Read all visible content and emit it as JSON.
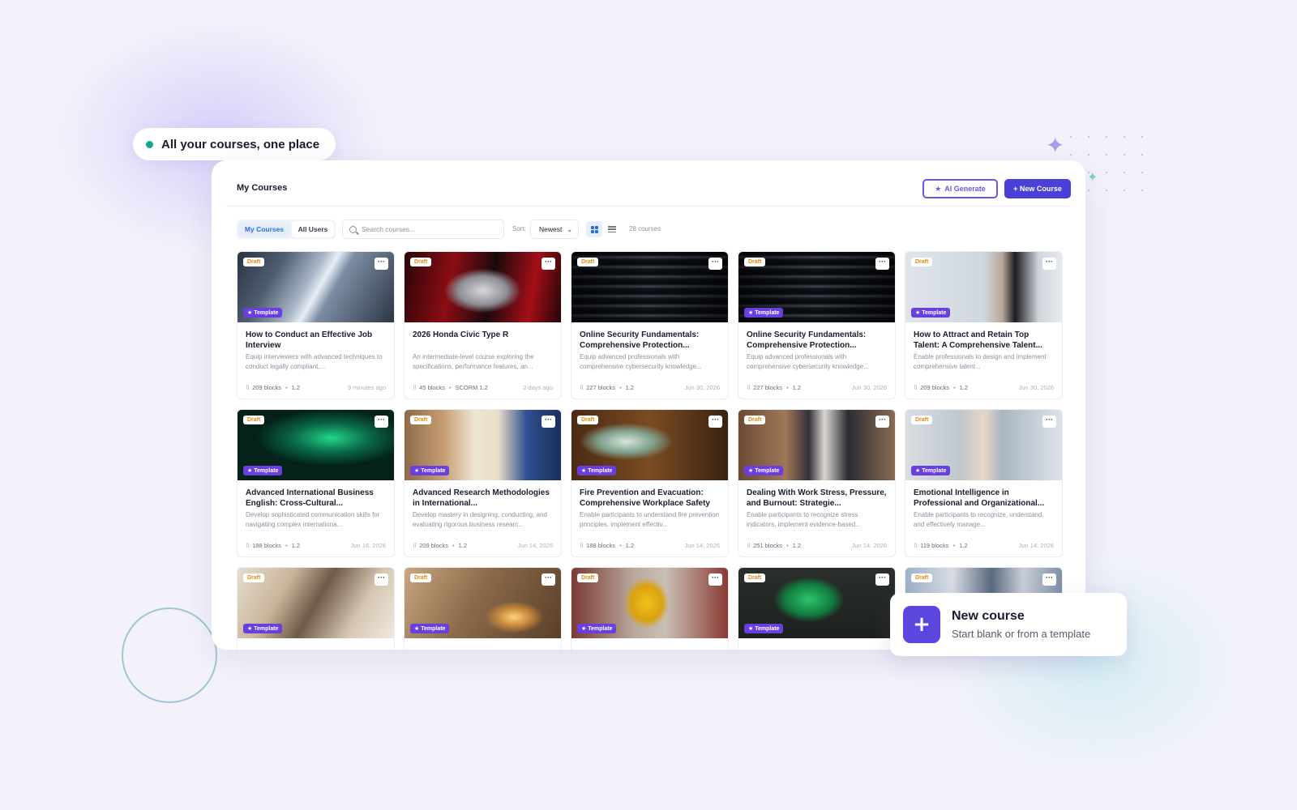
{
  "pill": {
    "label": "All your courses, one place"
  },
  "header": {
    "title": "My Courses",
    "ai_generate_label": "AI Generate",
    "new_course_label": "+ New Course"
  },
  "toolbar": {
    "tabs": [
      {
        "label": "My Courses",
        "active": true
      },
      {
        "label": "All Users",
        "active": false
      }
    ],
    "search_placeholder": "Search courses...",
    "sort_label": "Sort:",
    "sort_value": "Newest",
    "course_count": "28 courses"
  },
  "cards": [
    {
      "badge": "Draft",
      "template": "★ Template",
      "title": "How to Conduct an Effective Job Interview",
      "desc": "Equip interviewers with advanced techniques to conduct legally compliant,...",
      "blocks": "209 blocks",
      "version": "1.2",
      "date": "9 minutes ago",
      "thumb": "arch"
    },
    {
      "badge": "Draft",
      "template": "",
      "title": "2026 Honda Civic Type R",
      "desc": "An intermediate-level course exploring the specifications, performance features, an...",
      "blocks": "45 blocks",
      "version": "SCORM 1.2",
      "date": "2 days ago",
      "thumb": "car"
    },
    {
      "badge": "Draft",
      "template": "",
      "title": "Online Security Fundamentals: Comprehensive Protection...",
      "desc": "Equip advanced professionals with comprehensive cybersecurity knowledge...",
      "blocks": "227 blocks",
      "version": "1.2",
      "date": "Jun 30, 2026",
      "thumb": "server"
    },
    {
      "badge": "Draft",
      "template": "★ Template",
      "title": "Online Security Fundamentals: Comprehensive Protection...",
      "desc": "Equip advanced professionals with comprehensive cybersecurity knowledge...",
      "blocks": "227 blocks",
      "version": "1.2",
      "date": "Jun 30, 2026",
      "thumb": "server"
    },
    {
      "badge": "Draft",
      "template": "★ Template",
      "title": "How to Attract and Retain Top Talent: A Comprehensive Talent...",
      "desc": "Enable professionals to design and implement comprehensive talent...",
      "blocks": "209 blocks",
      "version": "1.2",
      "date": "Jun 30, 2026",
      "thumb": "woman"
    },
    {
      "badge": "Draft",
      "template": "★ Template",
      "title": "Advanced International Business English: Cross-Cultural...",
      "desc": "Develop sophisticated communication skills for navigating complex internationa...",
      "blocks": "188 blocks",
      "version": "1.2",
      "date": "Jun 16, 2026",
      "thumb": "green"
    },
    {
      "badge": "Draft",
      "template": "★ Template",
      "title": "Advanced Research Methodologies in International...",
      "desc": "Develop mastery in designing, conducting, and evaluating rigorous business researc...",
      "blocks": "209 blocks",
      "version": "1.2",
      "date": "Jun 14, 2026",
      "thumb": "writing"
    },
    {
      "badge": "Draft",
      "template": "★ Template",
      "title": "Fire Prevention and Evacuation: Comprehensive Workplace Safety",
      "desc": "Enable participants to understand fire prevention principles, implement effectiv...",
      "blocks": "188 blocks",
      "version": "1.2",
      "date": "Jun 14, 2026",
      "thumb": "exit"
    },
    {
      "badge": "Draft",
      "template": "★ Template",
      "title": "Dealing With Work Stress, Pressure, and Burnout: Strategie...",
      "desc": "Enable participants to recognize stress indicators, implement evidence-based...",
      "blocks": "251 blocks",
      "version": "1.2",
      "date": "Jun 14, 2026",
      "thumb": "stress"
    },
    {
      "badge": "Draft",
      "template": "★ Template",
      "title": "Emotional Intelligence in Professional and Organizational...",
      "desc": "Enable participants to recognize, understand, and effectively manage...",
      "blocks": "119 blocks",
      "version": "1.2",
      "date": "Jun 14, 2026",
      "thumb": "glasses"
    },
    {
      "badge": "Draft",
      "template": "★ Template",
      "title": "",
      "desc": "",
      "blocks": "",
      "version": "",
      "date": "",
      "thumb": "success"
    },
    {
      "badge": "Draft",
      "template": "★ Template",
      "title": "",
      "desc": "",
      "blocks": "",
      "version": "",
      "date": "",
      "thumb": "candle"
    },
    {
      "badge": "Draft",
      "template": "★ Template",
      "title": "",
      "desc": "",
      "blocks": "",
      "version": "",
      "date": "",
      "thumb": "caution"
    },
    {
      "badge": "Draft",
      "template": "★ Template",
      "title": "",
      "desc": "",
      "blocks": "",
      "version": "",
      "date": "",
      "thumb": "exitsign"
    },
    {
      "badge": "Draft",
      "template": "",
      "title": "",
      "desc": "",
      "blocks": "",
      "version": "",
      "date": "",
      "thumb": "office"
    }
  ],
  "toast": {
    "title": "New course",
    "subtitle": "Start blank or from a template"
  },
  "colors": {
    "accent": "#4a3fd9",
    "template_badge": "#6a3fe0",
    "draft_text": "#e08a12",
    "status_dot": "#10a98a"
  },
  "icons": {
    "ai": "sparkle-icon",
    "search": "search-icon",
    "menu": "more-icon",
    "blocks": "blocks-icon",
    "add": "plus-icon"
  }
}
